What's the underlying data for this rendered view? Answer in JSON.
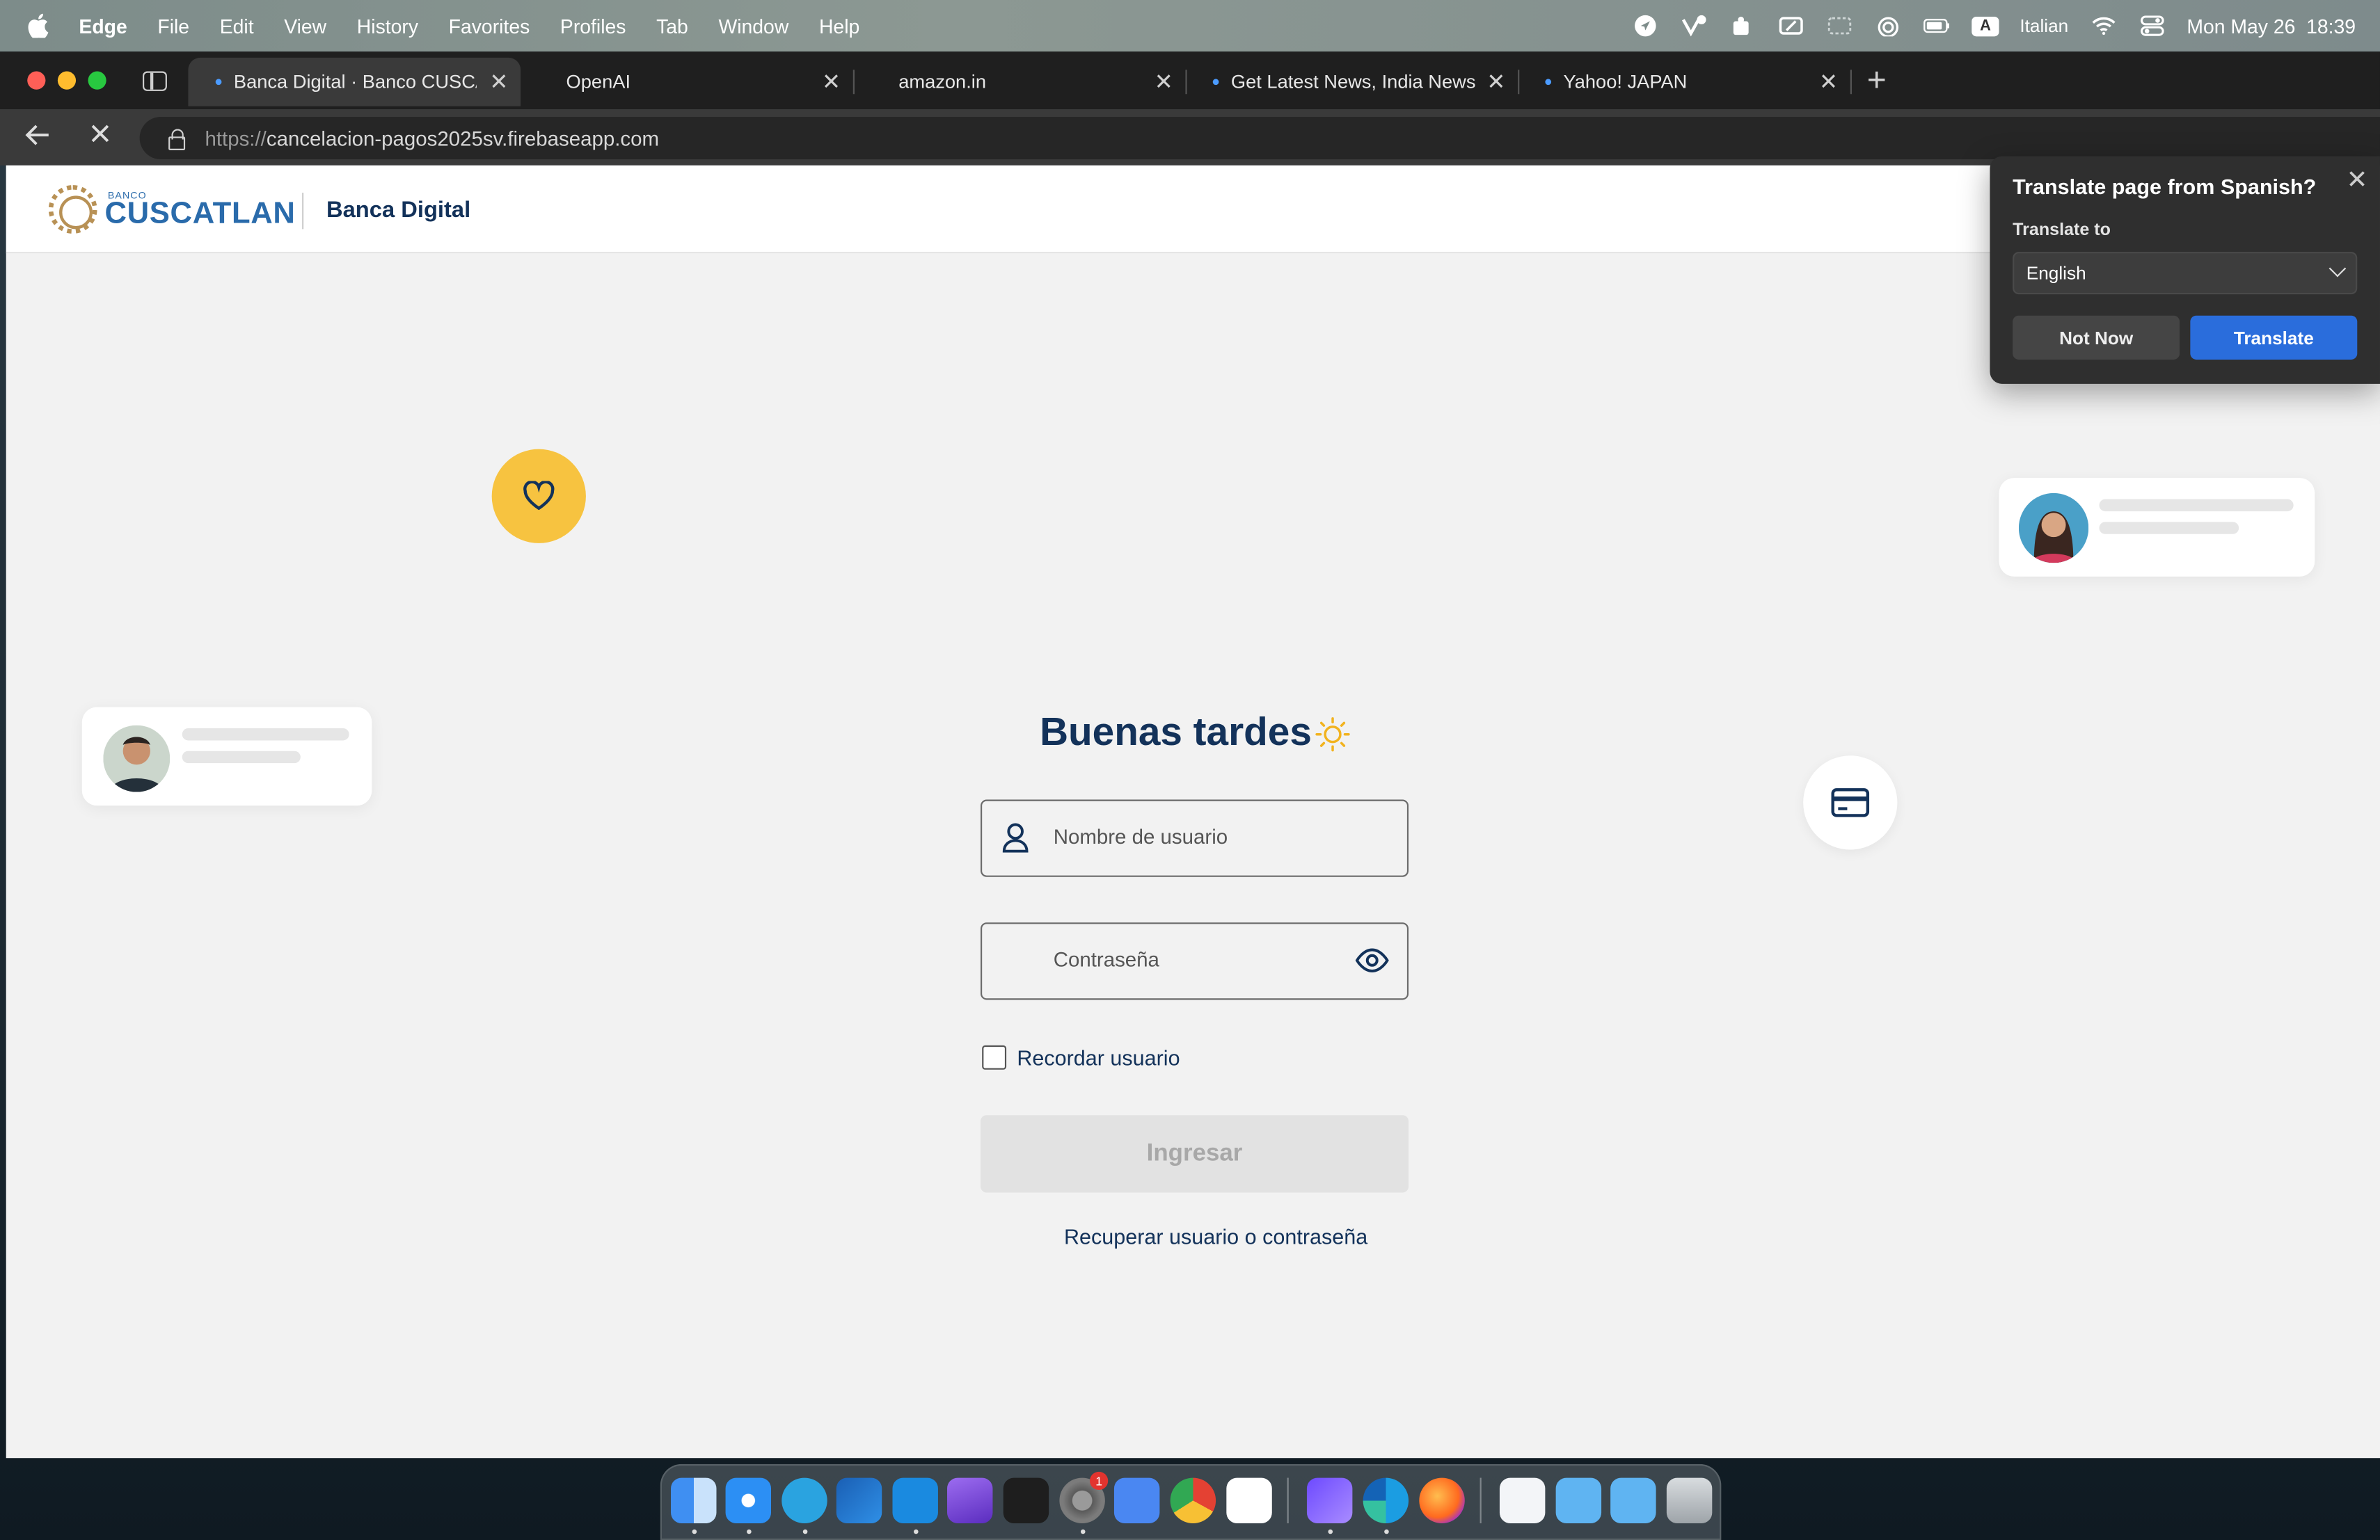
{
  "menubar": {
    "app": "Edge",
    "items": [
      "File",
      "Edit",
      "View",
      "History",
      "Favorites",
      "Profiles",
      "Tab",
      "Window",
      "Help"
    ],
    "input_source_badge": "A",
    "input_source": "Italian",
    "datetime": "Mon May 26  18:39"
  },
  "tabs": [
    {
      "title": "Banca Digital · Banco CUSCATL",
      "active": true
    },
    {
      "title": "OpenAI",
      "active": false
    },
    {
      "title": "amazon.in",
      "active": false
    },
    {
      "title": "Get Latest News, India News, B",
      "active": false
    },
    {
      "title": "Yahoo! JAPAN",
      "active": false
    }
  ],
  "address": {
    "protocol": "https://",
    "host": "cancelacion-pagos2025sv.firebaseapp.com"
  },
  "site": {
    "logo_small": "BANCO",
    "logo_text": "CUSCATLAN",
    "subtitle": "Banca Digital",
    "brand_color": "#13325a"
  },
  "login": {
    "greeting": "Buenas tardes",
    "username_placeholder": "Nombre de usuario",
    "password_placeholder": "Contraseña",
    "remember_label": "Recordar usuario",
    "submit_label": "Ingresar",
    "recover_link": "Recuperar usuario o contraseña"
  },
  "translate_popup": {
    "title": "Translate page from Spanish?",
    "label": "Translate to",
    "selected_language": "English",
    "not_now": "Not Now",
    "translate": "Translate",
    "accent": "#2a6ddc"
  },
  "dock": {
    "settings_badge": "1"
  }
}
